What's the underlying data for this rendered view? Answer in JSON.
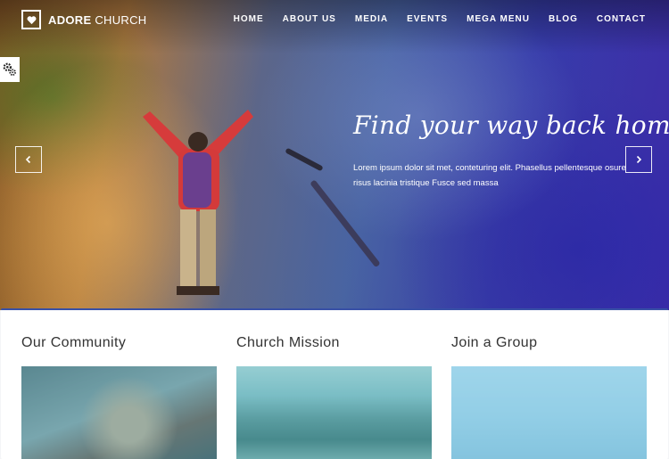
{
  "site": {
    "brand_bold": "ADORE",
    "brand_rest": " CHURCH"
  },
  "nav": [
    {
      "label": "HOME"
    },
    {
      "label": "ABOUT US"
    },
    {
      "label": "MEDIA"
    },
    {
      "label": "EVENTS"
    },
    {
      "label": "MEGA MENU"
    },
    {
      "label": "BLOG"
    },
    {
      "label": "CONTACT"
    }
  ],
  "slider": {
    "headline": "Find your way back home",
    "text": "Lorem ipsum dolor sit met, conteturing elit. Phasellus pellentesque osure risus lacinia tristique Fusce sed massa",
    "prev_icon": "chevron-left-icon",
    "next_icon": "chevron-right-icon"
  },
  "sections": [
    {
      "title": "Our Community"
    },
    {
      "title": "Church Mission"
    },
    {
      "title": "Join a Group"
    }
  ],
  "colors": {
    "accent": "#3850a6",
    "heading": "#333333"
  }
}
